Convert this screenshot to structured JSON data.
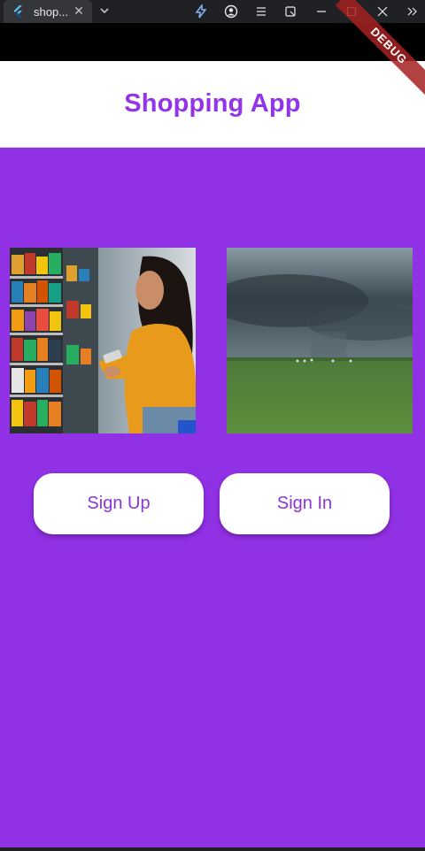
{
  "window": {
    "tab_title": "shop...",
    "tab_close": "✕",
    "icons": [
      "flutter-icon",
      "chevron-down-icon",
      "lightning-icon",
      "profile-icon",
      "menu-icon",
      "extension-icon",
      "minimize-icon",
      "maximize-icon",
      "close-icon",
      "overflow-icon"
    ]
  },
  "app": {
    "title": "Shopping App",
    "debug_banner": "DEBUG"
  },
  "buttons": {
    "sign_up": "Sign Up",
    "sign_in": "Sign In"
  },
  "colors": {
    "brand_purple": "#9131e6",
    "title_purple": "#9334e6",
    "button_text": "#8a35d8",
    "button_bg": "#ffffff"
  }
}
